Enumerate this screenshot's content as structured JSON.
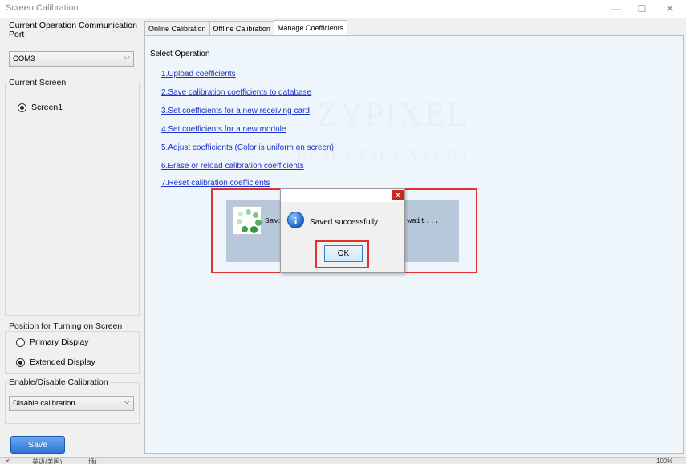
{
  "window": {
    "title": "Screen Calibration",
    "minimize": "—",
    "maximize": "☐",
    "close": "✕"
  },
  "left": {
    "port_label": "Current Operation Communication Port",
    "port_value": "COM3",
    "current_screen_label": "Current Screen",
    "screen_option": "Screen1",
    "position_label": "Position for Turning on Screen",
    "primary_display": "Primary Display",
    "extended_display": "Extended Display",
    "enable_label": "Enable/Disable Calibration",
    "enable_value": "Disable calibration",
    "save_label": "Save"
  },
  "tabs": [
    "Online Calibration",
    "Offline Calibration",
    "Manage Coefficients"
  ],
  "content": {
    "select_operation": "Select Operation",
    "links": [
      "1.Upload coefficients",
      "2.Save calibration coefficients to database",
      "3.Set coefficients for a new receiving card",
      "4.Set coefficients for a new module",
      "5.Adjust coefficients (Color is uniform on screen)",
      "6.Erase or reload calibration coefficients",
      "7.Reset calibration coefficients"
    ],
    "watermark_main": "ZYPIXEL",
    "watermark_sub": "LCD LED EXPERT"
  },
  "saving": {
    "text_start": "Savi",
    "text_end": "e wait..."
  },
  "dialog": {
    "close": "x",
    "message": "Saved successfully",
    "ok_label": "OK",
    "icon": "i"
  },
  "taskbar": {
    "left_text": "英语(美国)",
    "mid_text": "插)",
    "zoom": "100%"
  }
}
